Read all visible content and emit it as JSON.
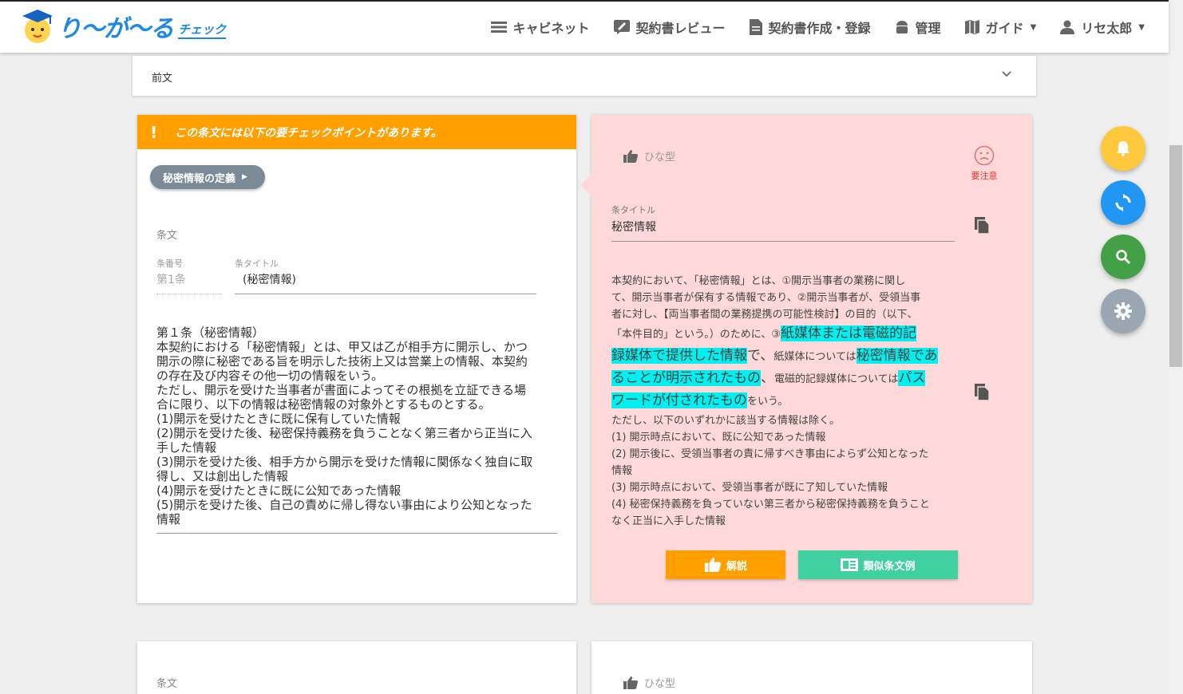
{
  "app": {
    "logo_text": "り〜が〜る",
    "logo_sub": "チェック"
  },
  "nav": {
    "cabinet": "キャビネット",
    "review": "契約書レビュー",
    "create": "契約書作成・登録",
    "admin": "管理",
    "guide": "ガイド",
    "user": "リセ太郎"
  },
  "preamble": {
    "label": "前文"
  },
  "left": {
    "warning": "この条文には以下の要チェックポイントがあります。",
    "chip": "秘密情報の定義",
    "section_label": "条文",
    "num_label": "条番号",
    "num_value": "第1条",
    "title_label": "条タイトル",
    "title_value": "(秘密情報)",
    "body_lines": [
      "第１条（秘密情報）",
      "本契約における「秘密情報」とは、甲又は乙が相手方に開示し、かつ",
      "開示の際に秘密である旨を明示した技術上又は営業上の情報、本契約",
      "の存在及び内容その他一切の情報をいう。",
      "ただし、開示を受けた当事者が書面によってその根拠を立証できる場",
      "合に限り、以下の情報は秘密情報の対象外とするものとする。",
      "(1)開示を受けたときに既に保有していた情報",
      "(2)開示を受けた後、秘密保持義務を負うことなく第三者から正当に入",
      "手した情報",
      "(3)開示を受けた後、相手方から開示を受けた情報に関係なく独自に取",
      "得し、又は創出した情報",
      "(4)開示を受けたときに既に公知であった情報",
      "(5)開示を受けた後、自己の責めに帰し得ない事由により公知となった",
      "情報"
    ]
  },
  "right": {
    "template_label": "ひな型",
    "caution_label": "要注意",
    "title_label": "条タイトル",
    "title_value": "秘密情報",
    "body": {
      "p1": "本契約において、「秘密情報」とは、①開示当事者の業務に関し",
      "p2": "て、開示当事者が保有する情報であり、②開示当事者が、受領当事",
      "p3": "者に対し、【両当事者間の業務提携の可能性検討】の目的（以下、",
      "p4a": "「本件目的」という。）のために、③",
      "hl1a": "紙媒体または電磁的記",
      "hl1b": "録媒体で提供した情報",
      "t1": "で、",
      "t2": "紙媒体については",
      "hl2a": "秘密情報であ",
      "hl2b": "ることが明示されたもの",
      "t3": "、",
      "t4": "電磁的記録媒体については",
      "hl3a": "パス",
      "hl3b": "ワードが付されたもの",
      "t5": "をいう。",
      "lines": [
        "ただし、以下のいずれかに該当する情報は除く。",
        "(1) 開示時点において、既に公知であった情報",
        "(2) 開示後に、受領当事者の責に帰すべき事由によらず公知となった",
        "情報",
        "(3) 開示時点において、受領当事者が既に了知していた情報",
        "(4) 秘密保持義務を負っていない第三者から秘密保持義務を負うこと",
        "なく正当に入手した情報"
      ]
    },
    "explain_button": "解説",
    "similar_button": "類似条文例"
  },
  "bottom": {
    "left_label": "条文",
    "right_label": "ひな型"
  },
  "colors": {
    "accent_orange": "#ffa000",
    "accent_green": "#41d0a0",
    "highlight": "#00f0f0",
    "card_pink": "#ffd9d9"
  }
}
